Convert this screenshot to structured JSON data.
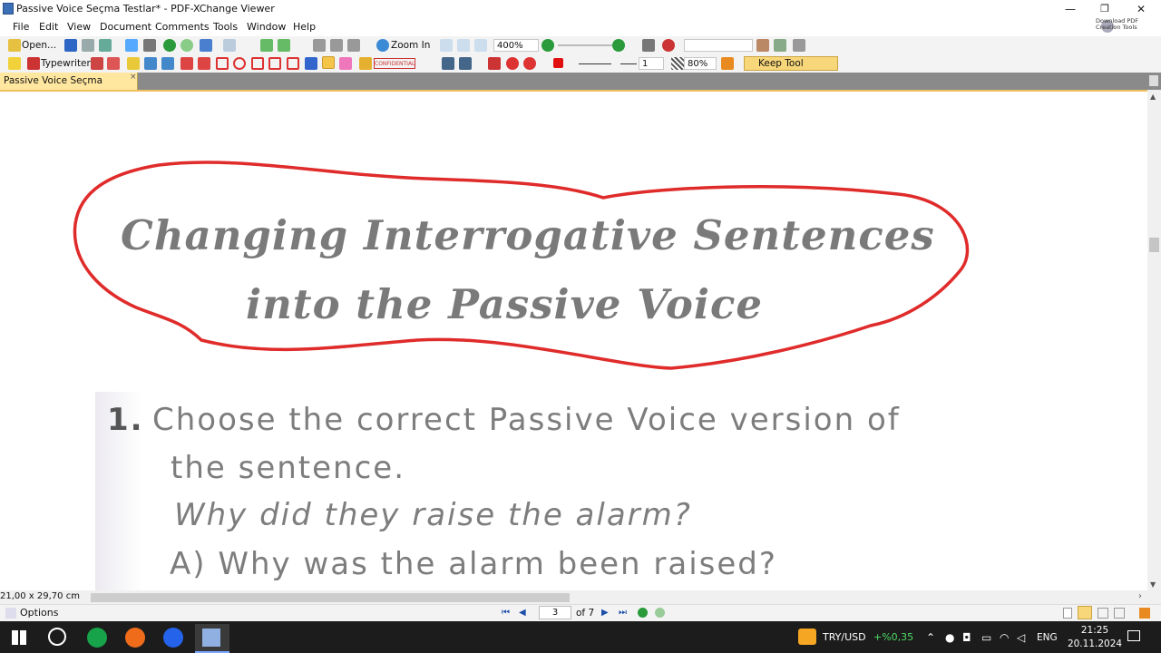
{
  "window": {
    "title": "Passive Voice Seçma Testlar* - PDF-XChange Viewer",
    "minimize": "—",
    "restore": "❐",
    "close": "✕"
  },
  "menu": [
    "File",
    "Edit",
    "View",
    "Document",
    "Comments",
    "Tools",
    "Window",
    "Help"
  ],
  "download_tools": "Download PDF Creation Tools",
  "toolbar1": {
    "open_label": "Open...",
    "zoom_in_label": "Zoom In",
    "zoom_value": "400%"
  },
  "toolbar2": {
    "typewriter_label": "Typewriter",
    "stamp_label": "CONFIDENTIAL",
    "line_width": "1",
    "opacity": "80%",
    "keep_tool_label": "Keep Tool Selected"
  },
  "tab": {
    "label": "Passive Voice Seçma Testlar*",
    "close": "×"
  },
  "document": {
    "heading_line1": "Changing Interrogative Sentences",
    "heading_line2": "into the Passive Voice",
    "question_number": "1.",
    "question_line1": "Choose the correct Passive Voice version of",
    "question_line2": "the sentence.",
    "sentence": "Why did they raise the alarm?",
    "option_a": "A) Why was the alarm been raised?"
  },
  "status": {
    "page_size": "21,00 x 29,70 cm",
    "options_label": "Options",
    "current_page": "3",
    "page_of": "of 7"
  },
  "taskbar": {
    "currency": "TRY/USD",
    "currency_change": "+%0,35",
    "language": "ENG",
    "time": "21:25",
    "date": "20.11.2024"
  },
  "colors": {
    "annotation_red": "#e02b2b",
    "tab_active": "#ffe7a0",
    "keep_tool_bg": "#f7d77a",
    "taskbar_bg": "#1c1c1c"
  }
}
